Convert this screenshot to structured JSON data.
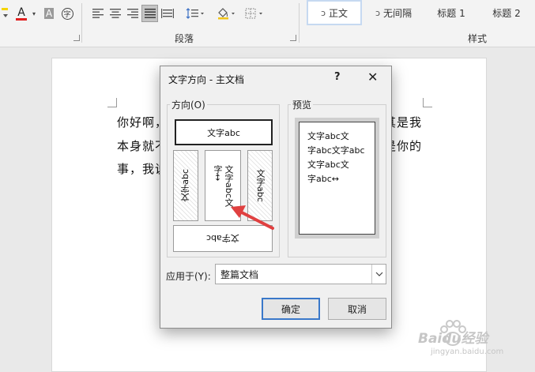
{
  "ribbon": {
    "paragraph_group_label": "段落",
    "styles_group_label": "样式",
    "styles": [
      {
        "label": "正文",
        "mark": "ↄ",
        "selected": true
      },
      {
        "label": "无间隔",
        "mark": "ↄ",
        "selected": false
      },
      {
        "label": "标题 1",
        "mark": "",
        "selected": false
      },
      {
        "label": "标题 2",
        "mark": "",
        "selected": false
      }
    ],
    "font_color_glyph": "A",
    "font_shade_glyph": "A",
    "enclose_glyph": "字"
  },
  "document": {
    "lines": [
      "你好啊，",
      "本身就不",
      "事，我说"
    ],
    "lines_right": [
      "其是我",
      "是你的"
    ]
  },
  "dialog": {
    "title": "文字方向 - 主文档",
    "help": "?",
    "close": "✕",
    "direction_label": "方向(O)",
    "preview_label": "预览",
    "options": {
      "horizontal": "文字abc",
      "vertical_left": "文字abc",
      "vertical_center_line1": "文字abc文",
      "vertical_center_line2": "字↔",
      "vertical_right": "文字abc",
      "rotated": "文字abc"
    },
    "preview_lines": [
      "文字abc文",
      "字abc文字abc",
      "文字abc文",
      "字abc↔"
    ],
    "apply_label": "应用于(Y):",
    "apply_value": "整篇文档",
    "ok": "确定",
    "cancel": "取消"
  },
  "watermark": {
    "text": "Baidu经验",
    "url_text": "jingyan.baidu.com"
  },
  "colors": {
    "font_red": "#e02020",
    "arrow_red": "#e04040",
    "default_button_border": "#3a78c9",
    "selected_style_border": "#c6d9f1"
  }
}
